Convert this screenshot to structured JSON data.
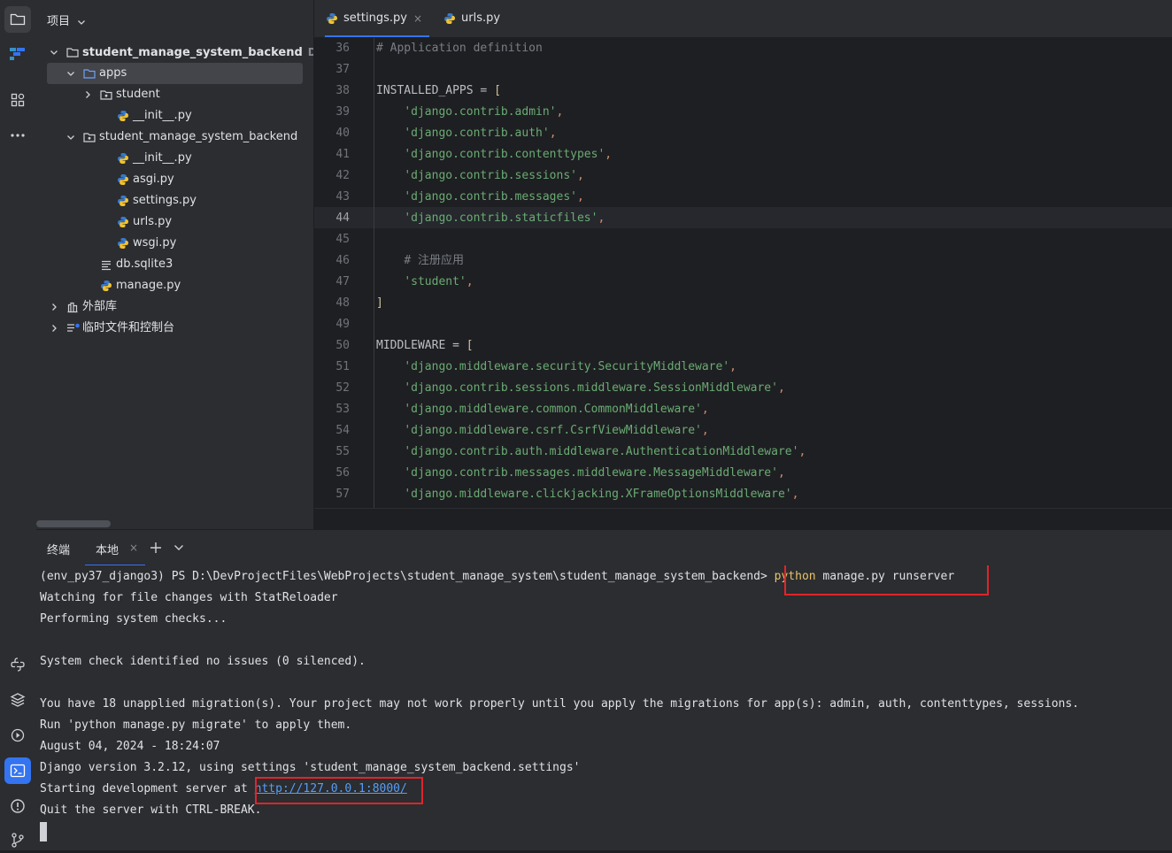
{
  "project_panel": {
    "title": "项目",
    "tree": [
      {
        "label": "student_manage_system_backend",
        "path": "D:\\Dev",
        "type": "folder",
        "expanded": true
      },
      {
        "label": "apps",
        "type": "folder",
        "expanded": true,
        "selected": true
      },
      {
        "label": "student",
        "type": "package",
        "expanded": false
      },
      {
        "label": "__init__.py",
        "type": "python"
      },
      {
        "label": "student_manage_system_backend",
        "type": "package",
        "expanded": true
      },
      {
        "label": "__init__.py",
        "type": "python"
      },
      {
        "label": "asgi.py",
        "type": "python"
      },
      {
        "label": "settings.py",
        "type": "python"
      },
      {
        "label": "urls.py",
        "type": "python"
      },
      {
        "label": "wsgi.py",
        "type": "python"
      },
      {
        "label": "db.sqlite3",
        "type": "db"
      },
      {
        "label": "manage.py",
        "type": "python"
      },
      {
        "label": "外部库",
        "type": "library",
        "expanded": false
      },
      {
        "label": "临时文件和控制台",
        "type": "scratches",
        "expanded": false
      }
    ]
  },
  "editor": {
    "tabs": [
      {
        "label": "settings.py",
        "active": true,
        "closable": true
      },
      {
        "label": "urls.py",
        "active": false
      }
    ],
    "current_line": 44,
    "lines": [
      {
        "n": "36",
        "segs": [
          [
            "cmt",
            "# Application definition"
          ]
        ]
      },
      {
        "n": "37",
        "segs": []
      },
      {
        "n": "38",
        "segs": [
          [
            "var",
            "INSTALLED_APPS = "
          ],
          [
            "brk",
            "["
          ]
        ]
      },
      {
        "n": "39",
        "segs": [
          [
            "var",
            "    "
          ],
          [
            "str",
            "'django.contrib.admin'"
          ],
          [
            "kw",
            ","
          ]
        ]
      },
      {
        "n": "40",
        "segs": [
          [
            "var",
            "    "
          ],
          [
            "str",
            "'django.contrib.auth'"
          ],
          [
            "kw",
            ","
          ]
        ]
      },
      {
        "n": "41",
        "segs": [
          [
            "var",
            "    "
          ],
          [
            "str",
            "'django.contrib.contenttypes'"
          ],
          [
            "kw",
            ","
          ]
        ]
      },
      {
        "n": "42",
        "segs": [
          [
            "var",
            "    "
          ],
          [
            "str",
            "'django.contrib.sessions'"
          ],
          [
            "kw",
            ","
          ]
        ]
      },
      {
        "n": "43",
        "segs": [
          [
            "var",
            "    "
          ],
          [
            "str",
            "'django.contrib.messages'"
          ],
          [
            "kw",
            ","
          ]
        ]
      },
      {
        "n": "44",
        "segs": [
          [
            "var",
            "    "
          ],
          [
            "str",
            "'django.contrib.staticfiles'"
          ],
          [
            "kw",
            ","
          ]
        ]
      },
      {
        "n": "45",
        "segs": []
      },
      {
        "n": "46",
        "segs": [
          [
            "var",
            "    "
          ],
          [
            "cmt",
            "# 注册应用"
          ]
        ]
      },
      {
        "n": "47",
        "segs": [
          [
            "var",
            "    "
          ],
          [
            "str",
            "'student'"
          ],
          [
            "kw",
            ","
          ]
        ]
      },
      {
        "n": "48",
        "segs": [
          [
            "brk",
            "]"
          ]
        ]
      },
      {
        "n": "49",
        "segs": []
      },
      {
        "n": "50",
        "segs": [
          [
            "var",
            "MIDDLEWARE = "
          ],
          [
            "brk",
            "["
          ]
        ]
      },
      {
        "n": "51",
        "segs": [
          [
            "var",
            "    "
          ],
          [
            "str",
            "'django.middleware.security.SecurityMiddleware'"
          ],
          [
            "kw",
            ","
          ]
        ]
      },
      {
        "n": "52",
        "segs": [
          [
            "var",
            "    "
          ],
          [
            "str",
            "'django.contrib.sessions.middleware.SessionMiddleware'"
          ],
          [
            "kw",
            ","
          ]
        ]
      },
      {
        "n": "53",
        "segs": [
          [
            "var",
            "    "
          ],
          [
            "str",
            "'django.middleware.common.CommonMiddleware'"
          ],
          [
            "kw",
            ","
          ]
        ]
      },
      {
        "n": "54",
        "segs": [
          [
            "var",
            "    "
          ],
          [
            "str",
            "'django.middleware.csrf.CsrfViewMiddleware'"
          ],
          [
            "kw",
            ","
          ]
        ]
      },
      {
        "n": "55",
        "segs": [
          [
            "var",
            "    "
          ],
          [
            "str",
            "'django.contrib.auth.middleware.AuthenticationMiddleware'"
          ],
          [
            "kw",
            ","
          ]
        ]
      },
      {
        "n": "56",
        "segs": [
          [
            "var",
            "    "
          ],
          [
            "str",
            "'django.contrib.messages.middleware.MessageMiddleware'"
          ],
          [
            "kw",
            ","
          ]
        ]
      },
      {
        "n": "57",
        "segs": [
          [
            "var",
            "    "
          ],
          [
            "str",
            "'django.middleware.clickjacking.XFrameOptionsMiddleware'"
          ],
          [
            "kw",
            ","
          ]
        ]
      }
    ]
  },
  "terminal": {
    "title": "终端",
    "tab_label": "本地",
    "prompt": "(env_py37_django3) PS D:\\DevProjectFiles\\WebProjects\\student_manage_system\\student_manage_system_backend> ",
    "command_program": "python",
    "command_args": " manage.py runserver",
    "output": [
      "Watching for file changes with StatReloader",
      "Performing system checks...",
      "",
      "System check identified no issues (0 silenced).",
      "",
      "You have 18 unapplied migration(s). Your project may not work properly until you apply the migrations for app(s): admin, auth, contenttypes, sessions.",
      "Run 'python manage.py migrate' to apply them.",
      "August 04, 2024 - 18:24:07",
      "Django version 3.2.12, using settings 'student_manage_system_backend.settings'"
    ],
    "server_prefix": "Starting development server at ",
    "server_url": "http://127.0.0.1:8000/",
    "quit_line": "Quit the server with CTRL-BREAK."
  },
  "colors": {
    "accent": "#3574f0",
    "highlight_box": "#e0242b",
    "link": "#589df6",
    "string": "#6aab73",
    "comment": "#7a7e85"
  }
}
